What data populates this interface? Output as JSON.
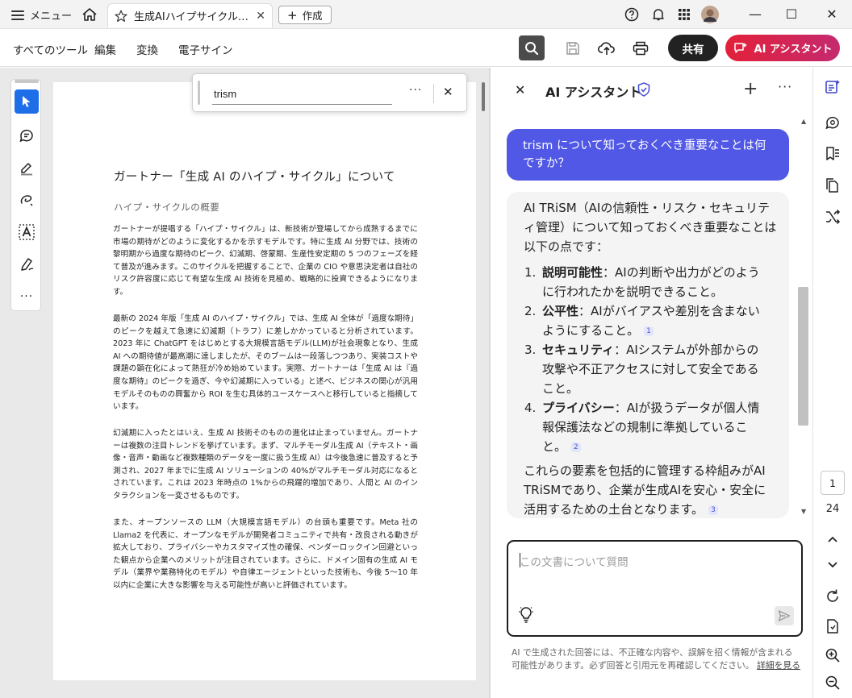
{
  "titlebar": {
    "menu_label": "メニュー",
    "tab_title": "生成AIハイプサイクル解...",
    "create_label": "作成",
    "win_minimize": "—",
    "win_maximize": "☐",
    "win_close": "✕"
  },
  "toolbar": {
    "items": [
      "すべてのツール",
      "編集",
      "変換",
      "電子サイン"
    ],
    "share_label": "共有",
    "ai_assistant_label": "AI アシスタント"
  },
  "find": {
    "query": "trism",
    "more": "···",
    "close": "✕"
  },
  "document": {
    "title": "ガートナー「生成 AI のハイプ・サイクル」について",
    "subtitle": "ハイプ・サイクルの概要",
    "paragraphs": [
      "ガートナーが提唱する「ハイプ・サイクル」は、新技術が登場してから成熟するまでに市場の期待がどのように変化するかを示すモデルです。特に生成 AI 分野では、技術の黎明期から過度な期待のピーク、幻滅期、啓蒙期、生産性安定期の 5 つのフェーズを経て普及が進みます。このサイクルを把握することで、企業の CIO や意思決定者は自社のリスク許容度に応じて有望な生成 AI 技術を見極め、戦略的に投資できるようになります。",
      "最新の 2024 年版「生成 AI のハイプ・サイクル」では、生成 AI 全体が「過度な期待」のピークを越えて急速に幻滅期（トラフ）に差しかかっていると分析されています。2023 年に ChatGPT をはじめとする大規模言語モデル(LLM)が社会現象となり、生成 AI への期待値が最高潮に達しましたが、そのブームは一段落しつつあり、実装コストや課題の顕在化によって熱狂が冷め始めています。実際、ガートナーは「生成 AI は『過度な期待』のピークを過ぎ、今や幻滅期に入っている」と述べ、ビジネスの関心が汎用モデルそのものの興奮から ROI を生む具体的ユースケースへと移行していると指摘しています。",
      "幻滅期に入ったとはいえ、生成 AI 技術そのものの進化は止まっていません。ガートナーは複数の注目トレンドを挙げています。まず、マルチモーダル生成 AI（テキスト・画像・音声・動画など複数種類のデータを一度に扱う生成 AI）は今後急速に普及すると予測され、2027 年までに生成 AI ソリューションの 40%がマルチモーダル対応になるとされています。これは 2023 年時点の 1%からの飛躍的増加であり、人間と AI のインタラクションを一変させるものです。",
      "また、オープンソースの LLM（大規模言語モデル）の台頭も重要です。Meta 社の Llama2 を代表に、オープンなモデルが開発者コミュニティで共有・改良される動きが拡大しており、プライバシーやカスタマイズ性の確保、ベンダーロックイン回避といった観点から企業へのメリットが注目されています。さらに、ドメイン固有の生成 AI モデル（業界や業務特化のモデル）や自律エージェントといった技術も、今後 5～10 年以内に企業に大きな影響を与える可能性が高いと評価されています。"
    ]
  },
  "ai_panel": {
    "title": "AI アシスタント",
    "user_question": "trism について知っておくべき重要なことは何ですか？",
    "answer_intro": "AI TRiSM（AIの信頼性・リスク・セキュリティ管理）について知っておくべき重要なことは以下の点です：",
    "points": [
      {
        "num": "1.",
        "term": "説明可能性",
        "text": "：AIの判断や出力がどのように行われたかを説明できること。",
        "cite": ""
      },
      {
        "num": "2.",
        "term": "公平性",
        "text": "：AIがバイアスや差別を含まないようにすること。",
        "cite": "1"
      },
      {
        "num": "3.",
        "term": "セキュリティ",
        "text": "：AIシステムが外部からの攻撃や不正アクセスに対して安全であること。",
        "cite": ""
      },
      {
        "num": "4.",
        "term": "プライバシー",
        "text": "：AIが扱うデータが個人情報保護法などの規制に準拠していること。",
        "cite": "2"
      }
    ],
    "conclusion": "これらの要素を包括的に管理する枠組みがAI TRiSMであり、企業が生成AIを安心・安全に活用するための土台となります。",
    "conclusion_cite": "3",
    "ask_placeholder": "この文書について質問",
    "disclaimer": "AI で生成された回答には、不正確な内容や、誤解を招く情報が含まれる可能性があります。必ず回答と引用元を再確認してください。",
    "disclaimer_link": "詳細を見る"
  },
  "right_rail": {
    "current_page": "1",
    "total_pages": "24"
  },
  "colors": {
    "accent_blue": "#1d6ee8",
    "user_bubble": "#5158e5",
    "ai_button_start": "#e3203a",
    "ai_button_end": "#c42a6e"
  }
}
